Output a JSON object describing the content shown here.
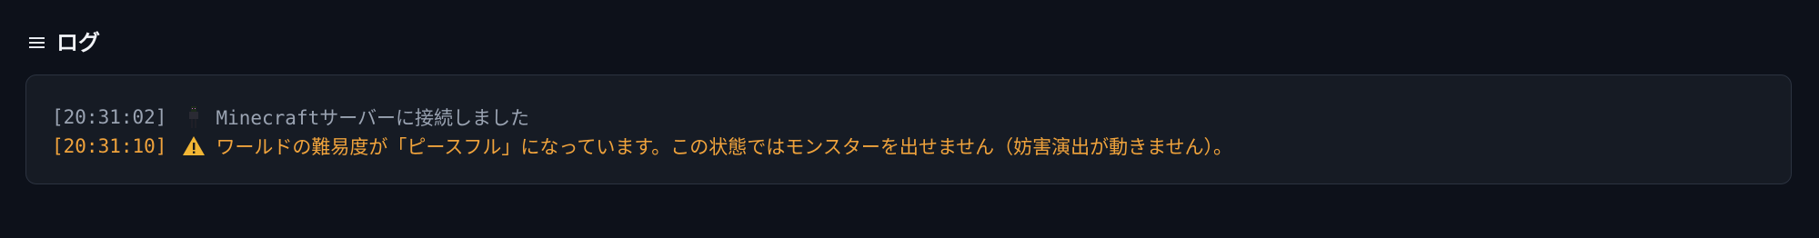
{
  "header": {
    "icon": "menu-icon",
    "title": "ログ"
  },
  "log": {
    "entries": [
      {
        "level": "info",
        "timestamp": "[20:31:02]",
        "icon": "minecraft-figure-icon",
        "message": "Minecraftサーバーに接続しました",
        "color": "#9aa3b2"
      },
      {
        "level": "warning",
        "timestamp": "[20:31:10]",
        "icon": "warning-icon",
        "message": "ワールドの難易度が「ピースフル」になっています。この状態ではモンスターを出せません（妨害演出が動きません）。",
        "color": "#f0a33c"
      }
    ]
  },
  "colors": {
    "background": "#0d111a",
    "panel": "#161b24",
    "panel_border": "#2c3340",
    "info_text": "#9aa3b2",
    "warning_text": "#f0a33c"
  }
}
